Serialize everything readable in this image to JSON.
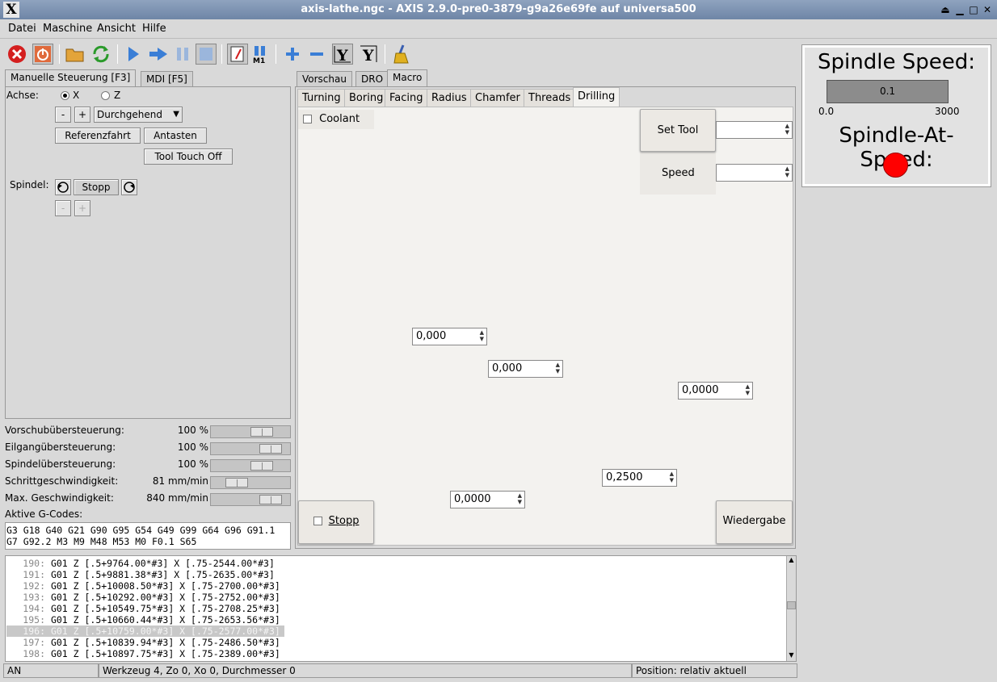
{
  "window": {
    "title": "axis-lathe.ngc - AXIS 2.9.0-pre0-3879-g9a26e69fe auf  universa500",
    "logo": "X"
  },
  "menu": [
    "Datei",
    "Maschine",
    "Ansicht",
    "Hilfe"
  ],
  "left_tabs": [
    "Manuelle Steuerung [F3]",
    "MDI [F5]"
  ],
  "manual": {
    "axis_label": "Achse:",
    "axis_x": "X",
    "axis_z": "Z",
    "minus": "-",
    "plus": "+",
    "jog_mode": "Durchgehend",
    "home_button": "Referenzfahrt",
    "touch_button": "Antasten",
    "tool_touch_off": "Tool Touch Off",
    "spindle_label": "Spindel:",
    "spindle_stop": "Stopp",
    "spindle_minus": "-",
    "spindle_plus": "+"
  },
  "overrides": [
    {
      "label": "Vorschubübersteuerung:",
      "value": "100 %",
      "level": 0.7
    },
    {
      "label": "Eilgangübersteuerung:",
      "value": "100 %",
      "level": 0.85
    },
    {
      "label": "Spindelübersteuerung:",
      "value": "100 %",
      "level": 0.7
    },
    {
      "label": "Schrittgeschwindigkeit:",
      "value": "81 mm/min",
      "level": 0.25
    },
    {
      "label": "Max. Geschwindigkeit:",
      "value": "840 mm/min",
      "level": 0.85
    }
  ],
  "gcodes": {
    "label": "Aktive G-Codes:",
    "line1": "G3 G18 G40 G21 G90 G95 G54 G49 G99 G64 G96 G91.1",
    "line2": "G7 G92.2 M3 M9 M48 M53 M0 F0.1 S65"
  },
  "right_tabs": [
    "Vorschau",
    "DRO",
    "Macro"
  ],
  "macro_tabs": [
    "Turning",
    "Boring",
    "Facing",
    "Radius",
    "Chamfer",
    "Threads",
    "Drilling"
  ],
  "drilling": {
    "coolant": "Coolant",
    "set_tool": "Set Tool",
    "speed": "Speed",
    "field1": "0,000",
    "field2": "0,000",
    "field3": "0,0000",
    "field4": "0,2500",
    "field5": "0,0000",
    "stop": "Stopp",
    "replay": "Wiedergabe"
  },
  "spindle_panel": {
    "speed_title": "Spindle Speed:",
    "bar_value": "0.1",
    "min": "0.0",
    "max": "3000",
    "at_speed_title": "Spindle-At-Speed:",
    "led_color": "#ff0000"
  },
  "code": [
    {
      "n": "190:",
      "t": "G01 Z [.5+9764.00*#3] X [.75-2544.00*#3]"
    },
    {
      "n": "191:",
      "t": "G01 Z [.5+9881.38*#3] X [.75-2635.00*#3]"
    },
    {
      "n": "192:",
      "t": "G01 Z [.5+10008.50*#3] X [.75-2700.00*#3]"
    },
    {
      "n": "193:",
      "t": "G01 Z [.5+10292.00*#3] X [.75-2752.00*#3]"
    },
    {
      "n": "194:",
      "t": "G01 Z [.5+10549.75*#3] X [.75-2708.25*#3]"
    },
    {
      "n": "195:",
      "t": "G01 Z [.5+10660.44*#3] X [.75-2653.56*#3]"
    },
    {
      "n": "196:",
      "t": "G01 Z [.5+10759.00*#3] X [.75-2577.00*#3]"
    },
    {
      "n": "197:",
      "t": "G01 Z [.5+10839.94*#3] X [.75-2486.50*#3]"
    },
    {
      "n": "198:",
      "t": "G01 Z [.5+10897.75*#3] X [.75-2389.00*#3]"
    }
  ],
  "status": {
    "state": "AN",
    "tool": "Werkzeug 4, Zo 0, Xo 0, Durchmesser 0",
    "position": "Position: relativ aktuell"
  }
}
